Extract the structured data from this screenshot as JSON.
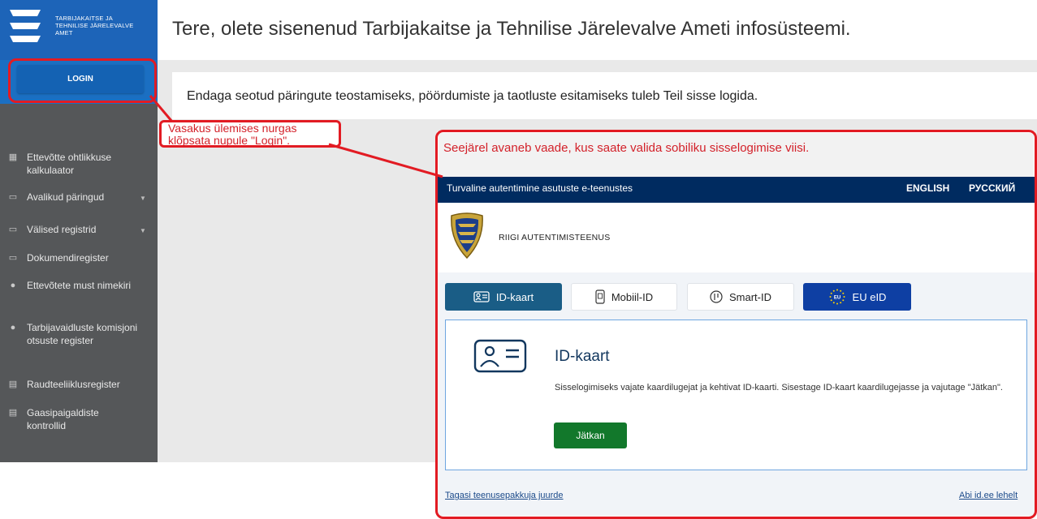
{
  "sidebar": {
    "brand_text_line1": "Tarbijakaitse ja",
    "brand_text_line2": "Tehnilise Järelevalve",
    "brand_text_line3": "Amet",
    "login_label": "LOGIN",
    "items": [
      {
        "icon": "calculator-icon",
        "label": "Ettevõtte ohtlikkuse kalkulaator"
      },
      {
        "icon": "folder-icon",
        "label": "Avalikud päringud",
        "has_chevron": true
      },
      {
        "icon": "folder-icon",
        "label": "Välised registrid",
        "has_chevron": true
      },
      {
        "icon": "folder-icon",
        "label": "Dokumendiregister"
      },
      {
        "icon": "dot-icon",
        "label": "Ettevõtete must nimekiri"
      },
      {
        "icon": "dot-icon",
        "label": "Tarbijavaidluste komisjoni otsuste register"
      },
      {
        "icon": "document-icon",
        "label": "Raudteeliiklusregister"
      },
      {
        "icon": "document-icon",
        "label": "Gaasipaigaldiste kontrollid"
      }
    ]
  },
  "header": {
    "title": "Tere, olete sisenenud Tarbijakaitse ja Tehnilise Järelevalve Ameti infosüsteemi."
  },
  "main": {
    "info_text": "Endaga seotud päringute teostamiseks, pöördumiste ja taotluste esitamiseks tuleb Teil sisse logida."
  },
  "annotations": {
    "left_note_line1": "Vasakus ülemises nurgas",
    "left_note_line2": "klõpsata nupule \"Login\".",
    "right_note": "Seejärel avaneb vaade, kus saate valida sobiliku sisselogimise viisi.",
    "color": "#e21b23"
  },
  "auth": {
    "bar_title": "Turvaline autentimine asutuste e-teenustes",
    "lang_english": "ENGLISH",
    "lang_russian": "РУССКИЙ",
    "service_name": "Riigi autentimisteenus",
    "tabs": [
      {
        "label": "ID-kaart",
        "icon": "id-card-icon",
        "active": true
      },
      {
        "label": "Mobiil-ID",
        "icon": "phone-icon"
      },
      {
        "label": "Smart-ID",
        "icon": "smart-id-icon"
      },
      {
        "label": "EU eID",
        "icon": "eu-flag-icon"
      }
    ],
    "card": {
      "title": "ID-kaart",
      "description": "Sisselogimiseks vajate kaardilugejat ja kehtivat ID-kaarti. Sisestage ID-kaart kaardilugejasse ja vajutage \"Jätkan\".",
      "button": "Jätkan"
    },
    "link_back": "Tagasi teenusepakkuja juurde",
    "link_help": "Abi id.ee lehelt"
  },
  "colors": {
    "sidebar": "#555759",
    "brand_blue": "#1d64b8",
    "auth_bar": "#002b60",
    "active_tab": "#1a5d86",
    "eu_tab": "#0e3fa3",
    "continue_button": "#12782b"
  }
}
